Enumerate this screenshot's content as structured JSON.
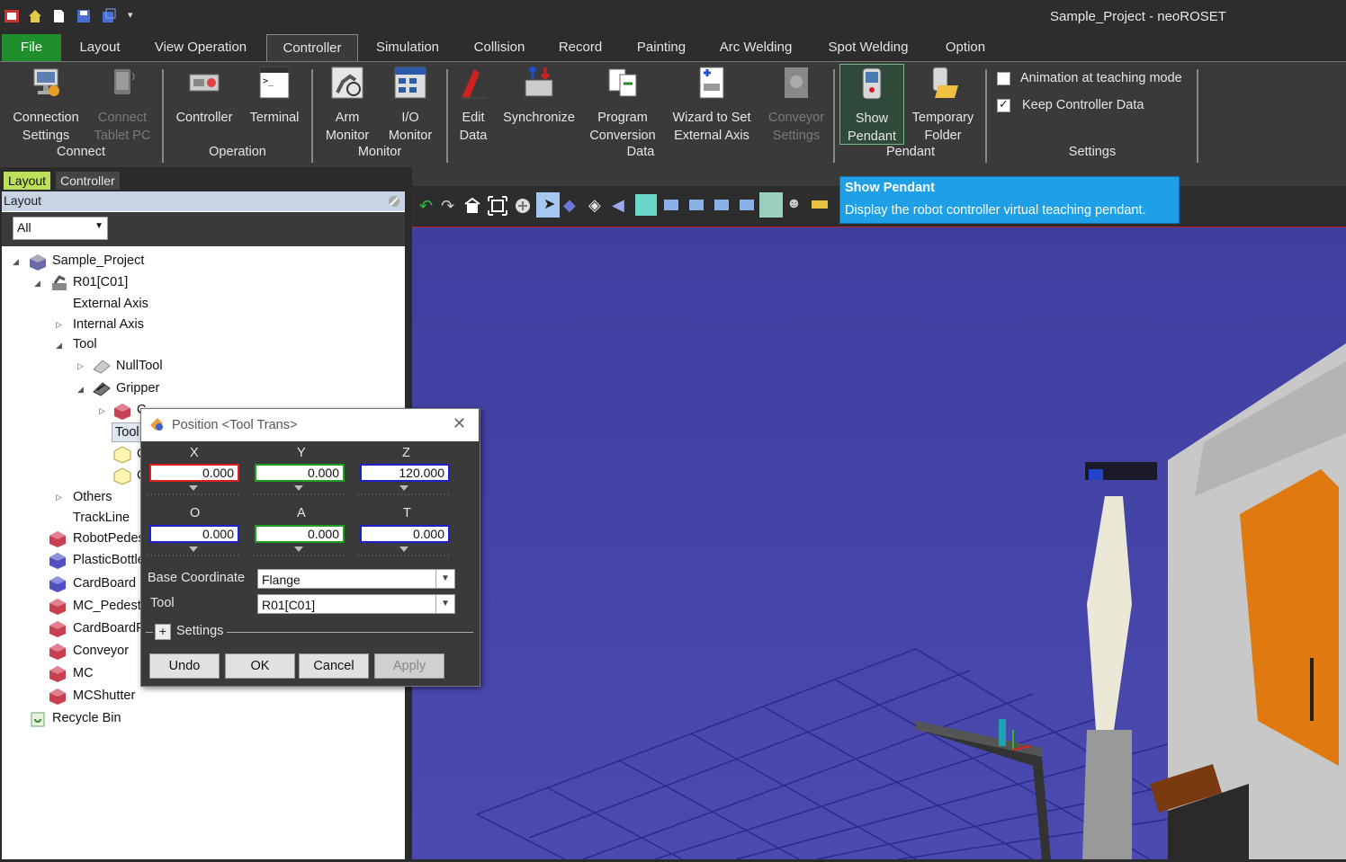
{
  "window": {
    "title": "Sample_Project - neoROSET"
  },
  "menu": {
    "items": [
      "File",
      "Layout",
      "View Operation",
      "Controller",
      "Simulation",
      "Collision",
      "Record",
      "Painting",
      "Arc Welding",
      "Spot Welding",
      "Option"
    ],
    "active": "Controller"
  },
  "ribbon": {
    "connect": {
      "group": "Connect",
      "connection_settings": [
        "Connection",
        "Settings"
      ],
      "connect_tablet": [
        "Connect",
        "Tablet PC"
      ]
    },
    "operation": {
      "group": "Operation",
      "controller": "Controller",
      "terminal": "Terminal"
    },
    "monitor": {
      "group": "Monitor",
      "arm_monitor": [
        "Arm",
        "Monitor"
      ],
      "io_monitor": [
        "I/O",
        "Monitor"
      ]
    },
    "data": {
      "group": "Data",
      "edit_data": [
        "Edit",
        "Data"
      ],
      "synchronize": "Synchronize",
      "program_conversion": [
        "Program",
        "Conversion"
      ],
      "wizard": [
        "Wizard to Set",
        "External Axis"
      ],
      "conveyor_settings": [
        "Conveyor",
        "Settings"
      ]
    },
    "pendant": {
      "group": "Pendant",
      "show_pendant": [
        "Show",
        "Pendant"
      ],
      "temporary_folder": [
        "Temporary",
        "Folder"
      ]
    },
    "settings": {
      "group": "Settings",
      "animation_label": "Animation at teaching mode",
      "animation_checked": false,
      "keep_label": "Keep Controller Data",
      "keep_checked": true
    }
  },
  "left_tabs": [
    "Layout",
    "Controller"
  ],
  "panel": {
    "header": "Layout",
    "filter": "All",
    "tree": {
      "project": "Sample_Project",
      "robot": "R01[C01]",
      "external_axis": "External Axis",
      "internal_axis": "Internal Axis",
      "tool": "Tool",
      "null_tool": "NullTool",
      "gripper": "Gripper",
      "tool_child_a": "C",
      "tool_trans": "Tool",
      "item_c1": "C",
      "item_c2": "C",
      "others": "Others",
      "trackline": "TrackLine",
      "objects": [
        "RobotPedes",
        "PlasticBottle",
        "CardBoard",
        "MC_Pedesta",
        "CardBoardP",
        "Conveyor",
        "MC",
        "MCShutter"
      ],
      "recycle_bin": "Recycle Bin"
    }
  },
  "dialog": {
    "title": "Position <Tool Trans>",
    "labels": {
      "x": "X",
      "y": "Y",
      "z": "Z",
      "o": "O",
      "a": "A",
      "t": "T"
    },
    "values": {
      "x": "0.000",
      "y": "0.000",
      "z": "120.000",
      "o": "0.000",
      "a": "0.000",
      "t": "0.000"
    },
    "base_coordinate_label": "Base Coordinate",
    "base_coordinate_value": "Flange",
    "tool_label": "Tool",
    "tool_value": "R01[C01]",
    "settings_label": "Settings",
    "buttons": {
      "undo": "Undo",
      "ok": "OK",
      "cancel": "Cancel",
      "apply": "Apply"
    }
  },
  "tooltip": {
    "title": "Show Pendant",
    "text": "Display the robot controller virtual teaching pendant."
  },
  "colors": {
    "file_tab": "#1f8f2e",
    "tooltip": "#1e9fe6",
    "viewport": "#4444a6",
    "x_axis": "#e02020",
    "y_axis": "#20a020",
    "z_axis": "#2020d0"
  }
}
